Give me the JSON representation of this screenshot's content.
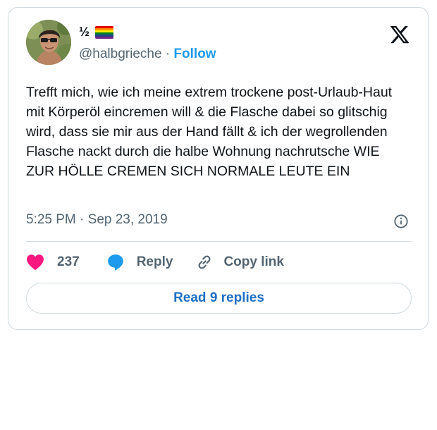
{
  "author": {
    "display_name": "½",
    "handle": "@halbgrieche",
    "separator": "·",
    "follow_label": "Follow",
    "pride_flag_colors": [
      "#e40303",
      "#ff8c00",
      "#ffed00",
      "#008026",
      "#24408e",
      "#732982"
    ]
  },
  "tweet": {
    "text": "Trefft mich, wie ich meine extrem trockene post-Urlaub-Haut mit Körperöl eincremen will & die Flasche dabei so glitschig wird, dass sie mir aus der Hand fällt & ich der wegrollenden Flasche nackt durch die halbe Wohnung nachrutsche WIE ZUR HÖLLE CREMEN SICH NORMALE LEUTE EIN",
    "timestamp": "5:25 PM · Sep 23, 2019"
  },
  "actions": {
    "like_count": "237",
    "reply_label": "Reply",
    "copy_link_label": "Copy link"
  },
  "read_replies_label": "Read 9 replies",
  "colors": {
    "accent": "#1d9bf0",
    "like": "#f91880",
    "secondary_text": "#536471",
    "border": "#cfd9de"
  },
  "icons": [
    "x-logo-icon",
    "info-icon",
    "heart-icon",
    "reply-bubble-icon",
    "link-icon"
  ]
}
